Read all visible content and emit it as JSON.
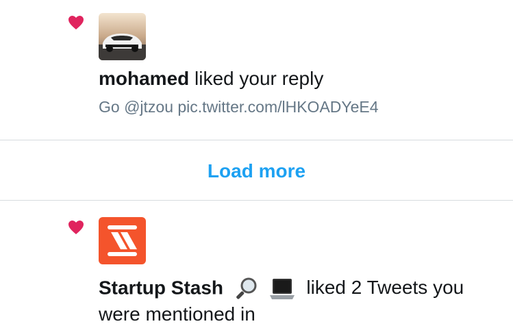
{
  "notifications": [
    {
      "user": "mohamed",
      "action": "liked your reply",
      "tweet_text": "Go @jtzou pic.twitter.com/lHKOADYeE4",
      "icon": "heart-icon",
      "avatar": "car-photo-avatar"
    },
    {
      "user": "Startup Stash",
      "emojis": [
        "magnifying-glass-icon",
        "laptop-icon"
      ],
      "action_line1": "liked 2 Tweets you",
      "action_line2": "were mentioned in",
      "icon": "heart-icon",
      "avatar": "startup-stash-logo"
    }
  ],
  "load_more": {
    "label": "Load more"
  },
  "colors": {
    "heart": "#e0245e",
    "link": "#1da1f2",
    "muted": "#657786",
    "logo_bg": "#f4542c"
  }
}
